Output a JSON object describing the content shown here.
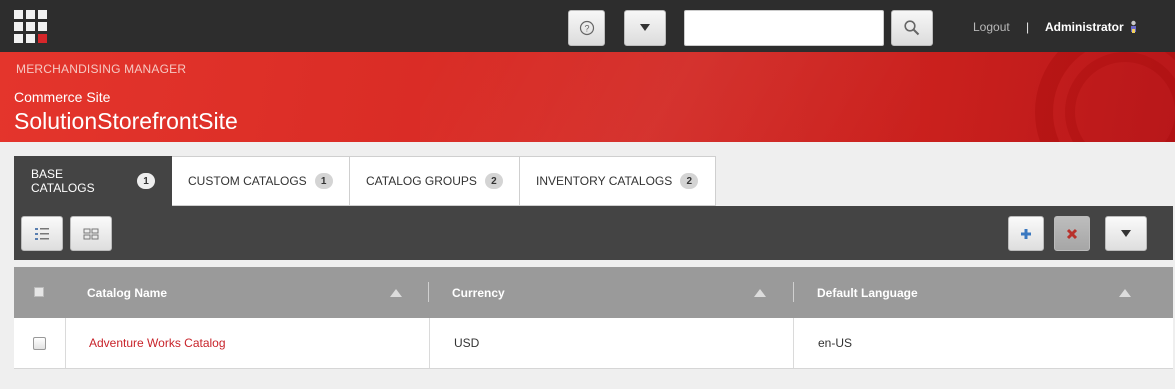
{
  "topbar": {
    "help_icon": "question-circle-icon",
    "menu_icon": "caret-down-icon",
    "search": {
      "value": "",
      "placeholder": ""
    },
    "search_icon": "magnifier-icon",
    "logout_label": "Logout",
    "separator": "|",
    "user_label": "Administrator",
    "user_icon": "user-icon"
  },
  "banner": {
    "app_name": "MERCHANDISING MANAGER",
    "site_label": "Commerce Site",
    "site_name": "SolutionStorefrontSite"
  },
  "tabs": [
    {
      "label": "BASE CATALOGS",
      "count": "1",
      "active": true
    },
    {
      "label": "CUSTOM CATALOGS",
      "count": "1",
      "active": false
    },
    {
      "label": "CATALOG GROUPS",
      "count": "2",
      "active": false
    },
    {
      "label": "INVENTORY CATALOGS",
      "count": "2",
      "active": false
    }
  ],
  "toolbar": {
    "list_view_icon": "list-view-icon",
    "grid_view_icon": "grid-view-icon",
    "add_icon": "plus-icon",
    "delete_icon": "x-icon",
    "more_icon": "caret-down-icon"
  },
  "table": {
    "columns": [
      "Catalog Name",
      "Currency",
      "Default Language"
    ],
    "rows": [
      {
        "catalog_name": "Adventure Works Catalog",
        "currency": "USD",
        "default_language": "en-US"
      }
    ]
  },
  "colors": {
    "accent_red": "#d72a24",
    "topbar_bg": "#2d2d2d",
    "toolbar_bg": "#444444",
    "header_bg": "#9a9a9a",
    "link_red": "#c8232a"
  }
}
